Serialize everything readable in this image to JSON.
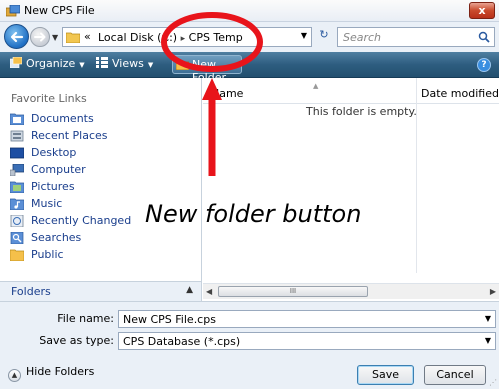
{
  "window": {
    "title": "New CPS File",
    "close_label": "x"
  },
  "addressbar": {
    "chevrons": "«",
    "segments": [
      "Local Disk (C:)",
      "CPS Temp"
    ],
    "separator": "▸",
    "search_placeholder": "Search"
  },
  "toolbar": {
    "organize_label": "Organize",
    "views_label": "Views",
    "new_folder_label": "New Folder",
    "help_label": "?"
  },
  "navpane": {
    "header": "Favorite Links",
    "items": [
      {
        "label": "Documents",
        "icon": "documents-icon"
      },
      {
        "label": "Recent Places",
        "icon": "recent-places-icon"
      },
      {
        "label": "Desktop",
        "icon": "desktop-icon"
      },
      {
        "label": "Computer",
        "icon": "computer-icon"
      },
      {
        "label": "Pictures",
        "icon": "pictures-icon"
      },
      {
        "label": "Music",
        "icon": "music-icon"
      },
      {
        "label": "Recently Changed",
        "icon": "recently-changed-icon"
      },
      {
        "label": "Searches",
        "icon": "searches-icon"
      },
      {
        "label": "Public",
        "icon": "public-folder-icon"
      }
    ],
    "folders_label": "Folders"
  },
  "filelist": {
    "col_name": "Name",
    "col_date": "Date modified",
    "empty_message": "This folder is empty.",
    "scroll_grip": "III"
  },
  "form": {
    "file_name_label": "File name:",
    "file_name_value": "New CPS File.cps",
    "save_type_label": "Save as type:",
    "save_type_value": "CPS Database (*.cps)"
  },
  "buttons": {
    "hide_folders": "Hide Folders",
    "save": "Save",
    "cancel": "Cancel"
  },
  "annotation": {
    "text": "New folder button",
    "color": "#e8141b"
  },
  "colors": {
    "toolbar": "#2e5d80",
    "link": "#1a3e8c",
    "pane_bg": "#eaf0f7"
  }
}
